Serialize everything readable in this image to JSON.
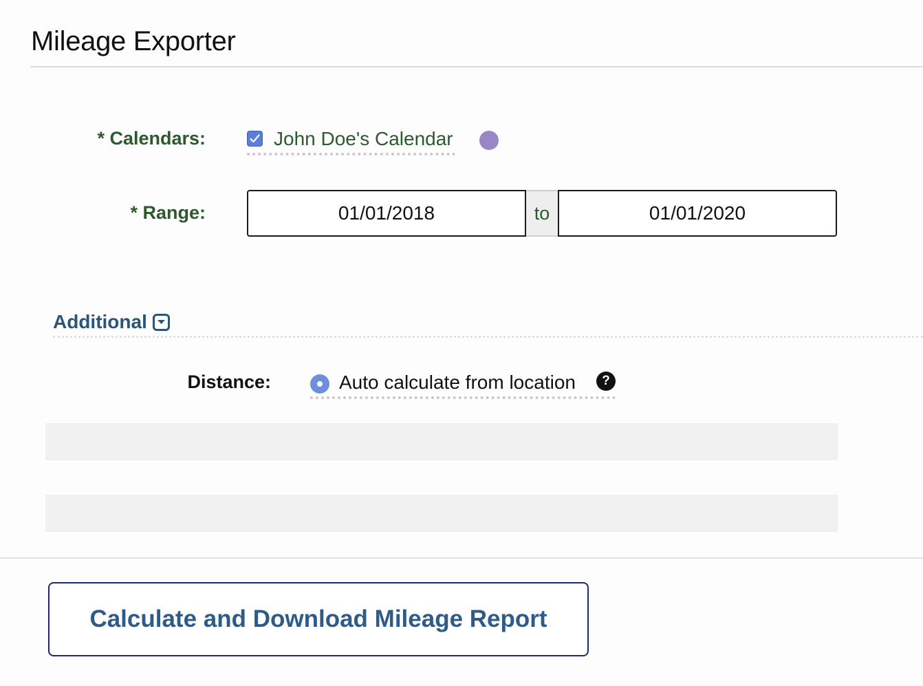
{
  "page": {
    "title": "Mileage Exporter"
  },
  "calendars": {
    "label": "* Calendars:",
    "items": [
      {
        "name": "John Doe's Calendar",
        "checked": true,
        "color": "#9a86c6"
      }
    ]
  },
  "range": {
    "label": "* Range:",
    "from": "01/01/2018",
    "separator": "to",
    "to": "01/01/2020"
  },
  "additional": {
    "label": "Additional",
    "icon": "chevron-down-box-icon"
  },
  "distance": {
    "label": "Distance:",
    "option": "Auto calculate from location",
    "selected": true,
    "help_icon": "?"
  },
  "actions": {
    "submit_label": "Calculate and Download Mileage Report"
  },
  "colors": {
    "label_green": "#2d5a2d",
    "section_blue": "#2b5577",
    "button_text": "#2e5b88",
    "button_border": "#1c2a66",
    "checkbox_blue": "#5b7fd6",
    "radio_blue": "#6d8fdc"
  }
}
